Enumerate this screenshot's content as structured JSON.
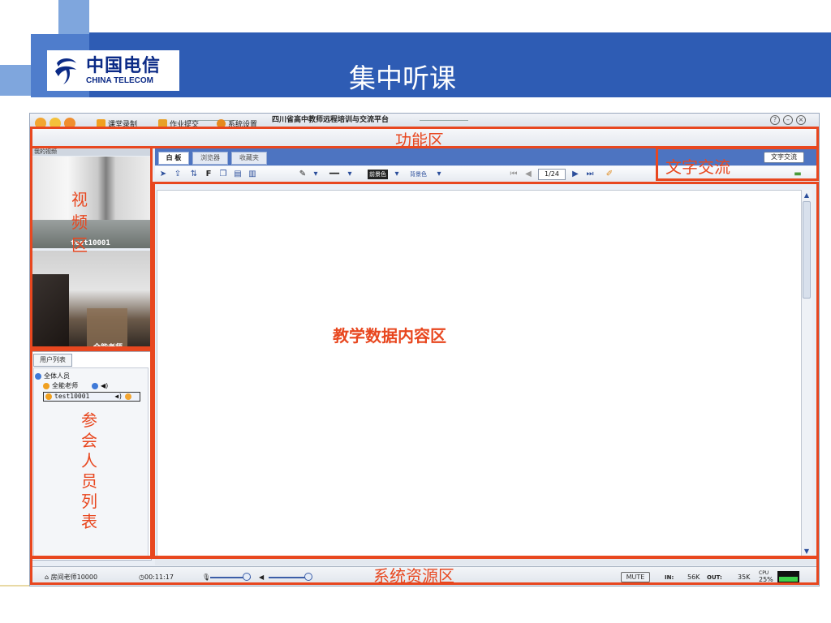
{
  "slide": {
    "title": "集中听课",
    "logo_cn": "中国电信",
    "logo_en": "CHINA TELECOM"
  },
  "app": {
    "window_title": "四川省高中教师远程培训与交流平台",
    "window_buttons": [
      "help-icon",
      "minimize-icon",
      "close-icon"
    ],
    "menu": {
      "record": "课堂录制",
      "homework": "作业提交",
      "settings": "系统设置"
    },
    "video": {
      "header": "我的视频",
      "cam1_label": "test10001",
      "cam2_label": "全能老师"
    },
    "userlist": {
      "tab": "用户列表",
      "root": "全体人员",
      "users": [
        "全能老师",
        "test10001"
      ]
    },
    "board": {
      "tabs": [
        "白 板",
        "浏览器",
        "收藏夹"
      ],
      "text_chat_button": "文字交流",
      "page": "1/24",
      "fg_label": "前景色",
      "bg_label": "背景色"
    },
    "status": {
      "room": "房间老师10000",
      "elapsed": "00:11:17",
      "mute": "MUTE",
      "in_label": "IN:",
      "in_value": "56K",
      "out_label": "OUT:",
      "out_value": "35K",
      "cpu_label": "CPU",
      "cpu_value": "25%"
    }
  },
  "annotations": {
    "function_area": "功能区",
    "video_area": "视频区",
    "users_area": "参会人员列表",
    "chat_area": "文字交流",
    "content_area": "教学数据内容区",
    "system_area": "系统资源区"
  },
  "colors": {
    "header_blue": "#2e5cb4",
    "annotation_red": "#e8471f",
    "tab_bar_blue": "#4d74c1"
  }
}
